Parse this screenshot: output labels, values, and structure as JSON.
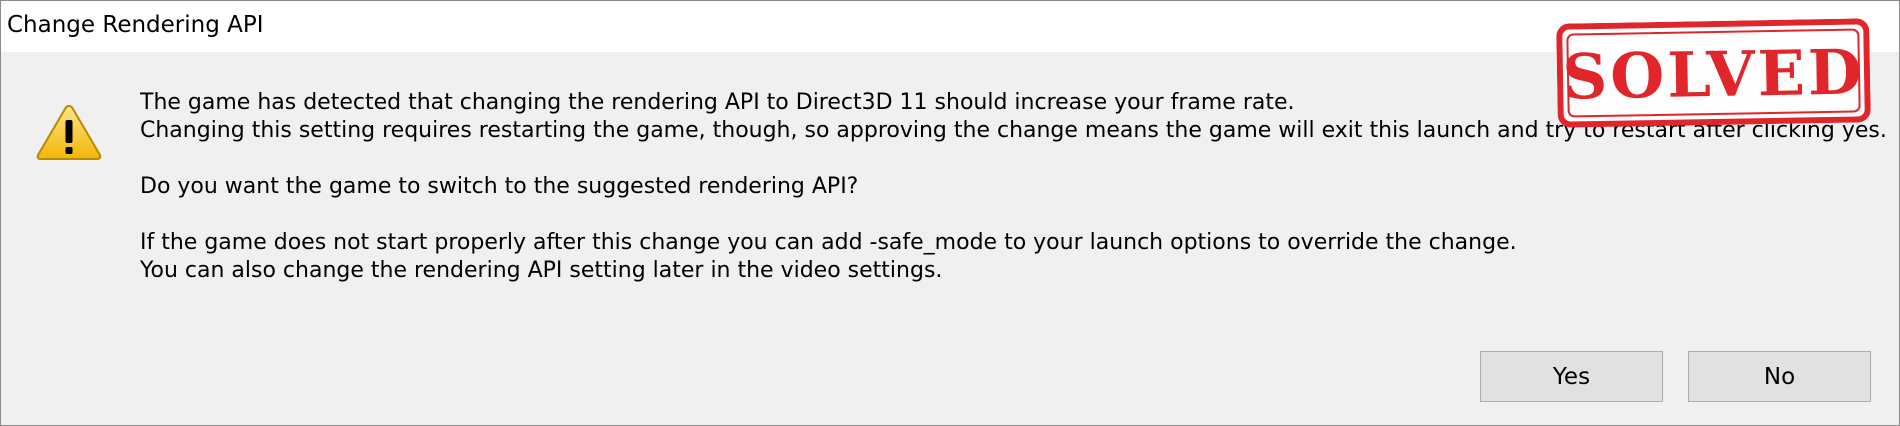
{
  "window": {
    "title": "Change Rendering API"
  },
  "message": {
    "line1": "The game has detected that changing the rendering API to Direct3D 11 should increase your frame rate.",
    "line2": "Changing this setting requires restarting the game, though, so approving the change means the game will exit this launch and try to restart after clicking yes.",
    "line3": "Do you want the game to switch to the suggested rendering API?",
    "line4": "If the game does not start properly after this change you can add -safe_mode to your launch options to override the change.",
    "line5": "You can also change the rendering API setting later in the video settings."
  },
  "buttons": {
    "yes_label": "Yes",
    "no_label": "No"
  },
  "overlay": {
    "stamp_text": "SOLVED",
    "stamp_color": "#e0262b"
  },
  "icons": {
    "warning": "warning-icon"
  },
  "colors": {
    "dialog_bg": "#f0f0f0",
    "titlebar_bg": "#ffffff",
    "button_bg": "#e1e1e1",
    "warning_yellow": "#f5c518"
  }
}
